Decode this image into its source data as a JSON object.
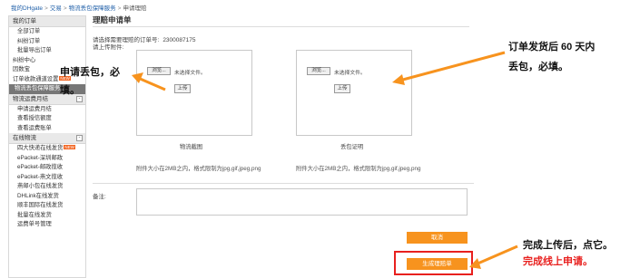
{
  "breadcrumb": {
    "items": [
      "我的DHgate",
      "交易",
      "物流丢包保障服务"
    ],
    "current": "申请理赔"
  },
  "sidebar": {
    "sections": [
      {
        "title": "我的订单",
        "toggle": "",
        "items": [
          {
            "label": "全部订单",
            "tag": ""
          },
          {
            "label": "纠纷订单",
            "tag": ""
          },
          {
            "label": "批量导出订单",
            "tag": ""
          }
        ]
      },
      {
        "title": "",
        "toggle": "",
        "items": [
          {
            "label": "纠纷中心",
            "tag": "",
            "flat": true
          },
          {
            "label": "因数宝",
            "tag": "",
            "flat": true
          },
          {
            "label": "订单收款通道设置",
            "tag": "NEW",
            "flat": true
          },
          {
            "label": "物流丢包保障服务",
            "tag": "",
            "active": true
          }
        ]
      },
      {
        "title": "物流运费月结",
        "toggle": "-",
        "items": [
          {
            "label": "申请运费月结",
            "tag": ""
          },
          {
            "label": "查看授信额度",
            "tag": ""
          },
          {
            "label": "查看运费账单",
            "tag": ""
          }
        ]
      },
      {
        "title": "在线物流",
        "toggle": "-",
        "items": [
          {
            "label": "四大快递在线发货",
            "tag": "NEW"
          },
          {
            "label": "ePacket-深圳邮政",
            "tag": ""
          },
          {
            "label": "ePacket-邮政揽收",
            "tag": ""
          },
          {
            "label": "ePacket-燕文揽收",
            "tag": ""
          },
          {
            "label": "燕邮小包在线发货",
            "tag": ""
          },
          {
            "label": "DHLink在线发货",
            "tag": ""
          },
          {
            "label": "顺丰国际在线发货",
            "tag": ""
          },
          {
            "label": "批量在线发货",
            "tag": ""
          },
          {
            "label": "运费单号管理",
            "tag": ""
          }
        ]
      }
    ]
  },
  "main": {
    "title": "理赔申请单",
    "order_label": "请选择需要理赔的订单号:",
    "order_number": "2300087175",
    "attach_label": "请上传附件:",
    "upload_boxes": [
      {
        "browse": "浏览...",
        "no_file": "未选择文件。",
        "upload": "上传",
        "caption": "物流截图",
        "limit": "附件大小在2MB之内，格式限制为jpg,gif,jpeg,png"
      },
      {
        "browse": "浏览...",
        "no_file": "未选择文件。",
        "upload": "上传",
        "caption": "丢包证明",
        "limit": "附件大小在2MB之内，格式限制为jpg,gif,jpeg,png"
      }
    ],
    "remark_label": "备注:",
    "remark_value": "",
    "cancel_label": "取消",
    "submit_label": "生成理赔单"
  },
  "annotations": {
    "note1_line1": "申请丢包，必",
    "note1_line2": "填。",
    "note2_line1": "订单发货后 60 天内",
    "note2_line2": "丢包，必填。",
    "note3": "完成上传后，点它。",
    "note4": "完成线上申请。"
  },
  "colors": {
    "accent_orange": "#f7931e",
    "highlight_red": "#e8201e",
    "link_blue": "#1f5fa8",
    "active_gray": "#777777"
  }
}
